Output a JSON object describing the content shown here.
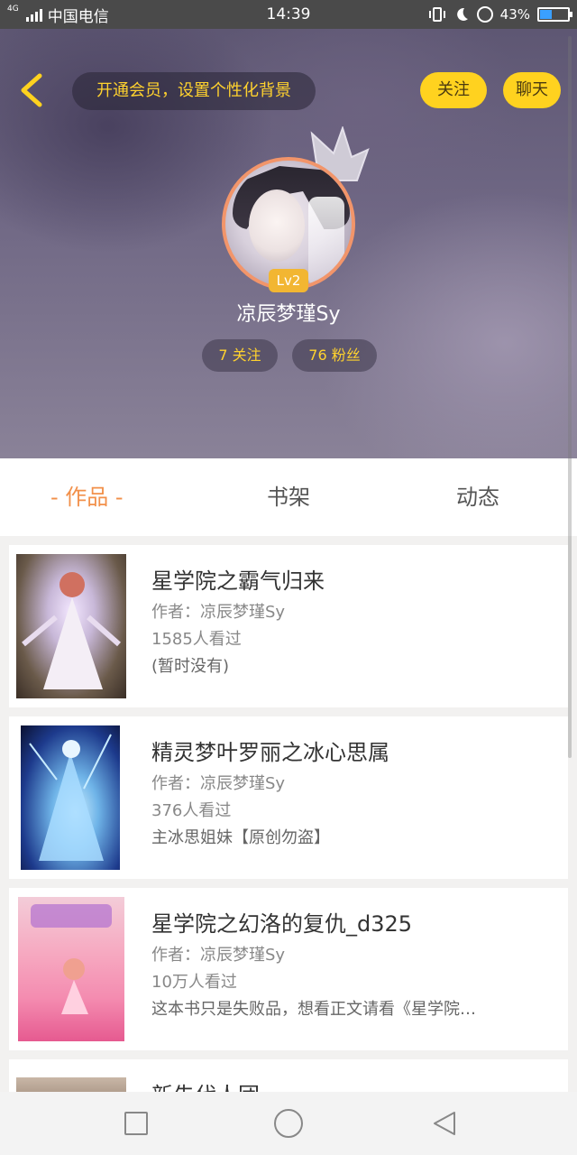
{
  "status_bar": {
    "carrier": "中国电信",
    "network": "4G",
    "time": "14:39",
    "battery_percent": "43%",
    "battery_level": 0.43
  },
  "top_bar": {
    "vip_banner": "开通会员，设置个性化背景",
    "follow_label": "关注",
    "chat_label": "聊天"
  },
  "profile": {
    "level": "Lv2",
    "username": "凉辰梦瑾Sy",
    "following": "7 关注",
    "fans": "76 粉丝"
  },
  "tabs": [
    {
      "label": "- 作品 -",
      "active": true
    },
    {
      "label": "书架",
      "active": false
    },
    {
      "label": "动态",
      "active": false
    }
  ],
  "works": [
    {
      "title": "星学院之霸气归来",
      "author": "作者：凉辰梦瑾Sy",
      "views": "1585人看过",
      "desc": "(暂时没有)"
    },
    {
      "title": "精灵梦叶罗丽之冰心思属",
      "author": "作者：凉辰梦瑾Sy",
      "views": "376人看过",
      "desc": "主冰思姐妹【原创勿盗】"
    },
    {
      "title": "星学院之幻洛的复仇_d325",
      "author": "作者：凉辰梦瑾Sy",
      "views": "10万人看过",
      "desc": "这本书只是失败品，想看正文请看《星学院…"
    },
    {
      "title": "新先代人团"
    }
  ],
  "colors": {
    "accent": "#ffd21f",
    "tab_active": "#f2904a",
    "avatar_border": "#f2956a",
    "level_badge": "#f2b632"
  }
}
